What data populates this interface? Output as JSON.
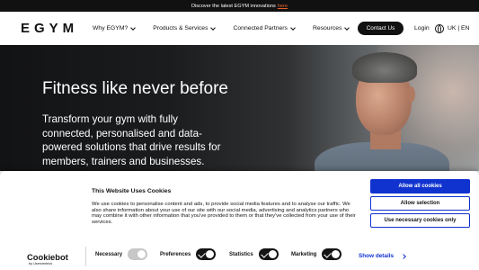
{
  "promo": {
    "text": "Discover the latest EGYM innovations",
    "link": "here"
  },
  "nav": {
    "logo": "EGYM",
    "menu": [
      "Why EGYM?",
      "Products & Services",
      "Connected Partners",
      "Resources"
    ],
    "contact": "Contact Us",
    "login": "Login",
    "language": "UK | EN"
  },
  "hero": {
    "title": "Fitness like never before",
    "subtitle": "Transform your gym with fully connected, personalised and data-powered solutions that drive results for members, trainers and businesses."
  },
  "cookie": {
    "title": "This Website Uses Cookies",
    "text": "We use cookies to personalise content and ads, to provide social media features and to analyse our traffic. We also share information about your use of our site with our social media, advertising and analytics partners who may combine it with other information that you've provided to them or that they've collected from your use of their services.",
    "allow_all": "Allow all cookies",
    "allow_selection": "Allow selection",
    "necessary_only": "Use necessary cookies only",
    "categories": [
      {
        "label": "Necessary",
        "enabled": true
      },
      {
        "label": "Preferences",
        "enabled": false
      },
      {
        "label": "Statistics",
        "enabled": false
      },
      {
        "label": "Marketing",
        "enabled": false
      }
    ],
    "show_details": "Show details",
    "brand": "Cookiebot",
    "brand_by": "by Usercentrics"
  },
  "colors": {
    "accent": "#e8612c",
    "cookie_blue": "#1032cf",
    "dark": "#111111"
  }
}
